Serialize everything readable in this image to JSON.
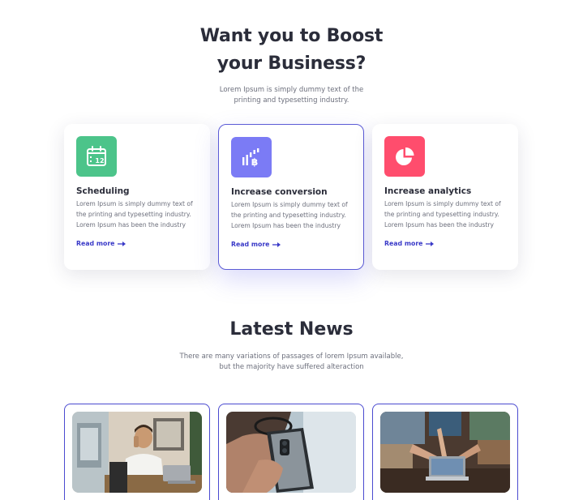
{
  "hero": {
    "title_line1": "Want you to Boost",
    "title_line2": "your Business?",
    "subtitle_line1": "Lorem Ipsum is simply dummy text of the",
    "subtitle_line2": "printing and typesetting industry."
  },
  "features": [
    {
      "title": "Scheduling",
      "icon": "calendar-icon",
      "icon_color": "#4cc48a",
      "icon_text": "12",
      "body_line1": "Lorem Ipsum is simply dummy text of",
      "body_line2": "the printing and typesetting industry.",
      "body_line3": "Lorem Ipsum has been the industry",
      "link": "Read more"
    },
    {
      "title": "Increase conversion",
      "icon": "bitcoin-chart-icon",
      "icon_color": "#7b7bf5",
      "body_line1": "Lorem Ipsum is simply dummy text of",
      "body_line2": "the printing and typesetting industry.",
      "body_line3": "Lorem Ipsum has been the industry",
      "link": "Read more"
    },
    {
      "title": "Increase analytics",
      "icon": "pie-chart-icon",
      "icon_color": "#ff4d6d",
      "body_line1": "Lorem Ipsum is simply dummy text of",
      "body_line2": "the printing and typesetting industry.",
      "body_line3": "Lorem Ipsum has been the industry",
      "link": "Read more"
    }
  ],
  "news": {
    "title": "Latest News",
    "subtitle_line1": "There are many variations of passages of lorem Ipsum available,",
    "subtitle_line2": "but the majority have suffered alteraction",
    "items": [
      {
        "image": "man-on-phone-photo"
      },
      {
        "image": "hand-holding-phone-photo"
      },
      {
        "image": "people-with-laptop-photo"
      }
    ]
  },
  "colors": {
    "accent": "#3a3ac8",
    "active_border": "#5b5bd6",
    "heading": "#2b2d3a",
    "body_text": "#6c6f7c"
  }
}
